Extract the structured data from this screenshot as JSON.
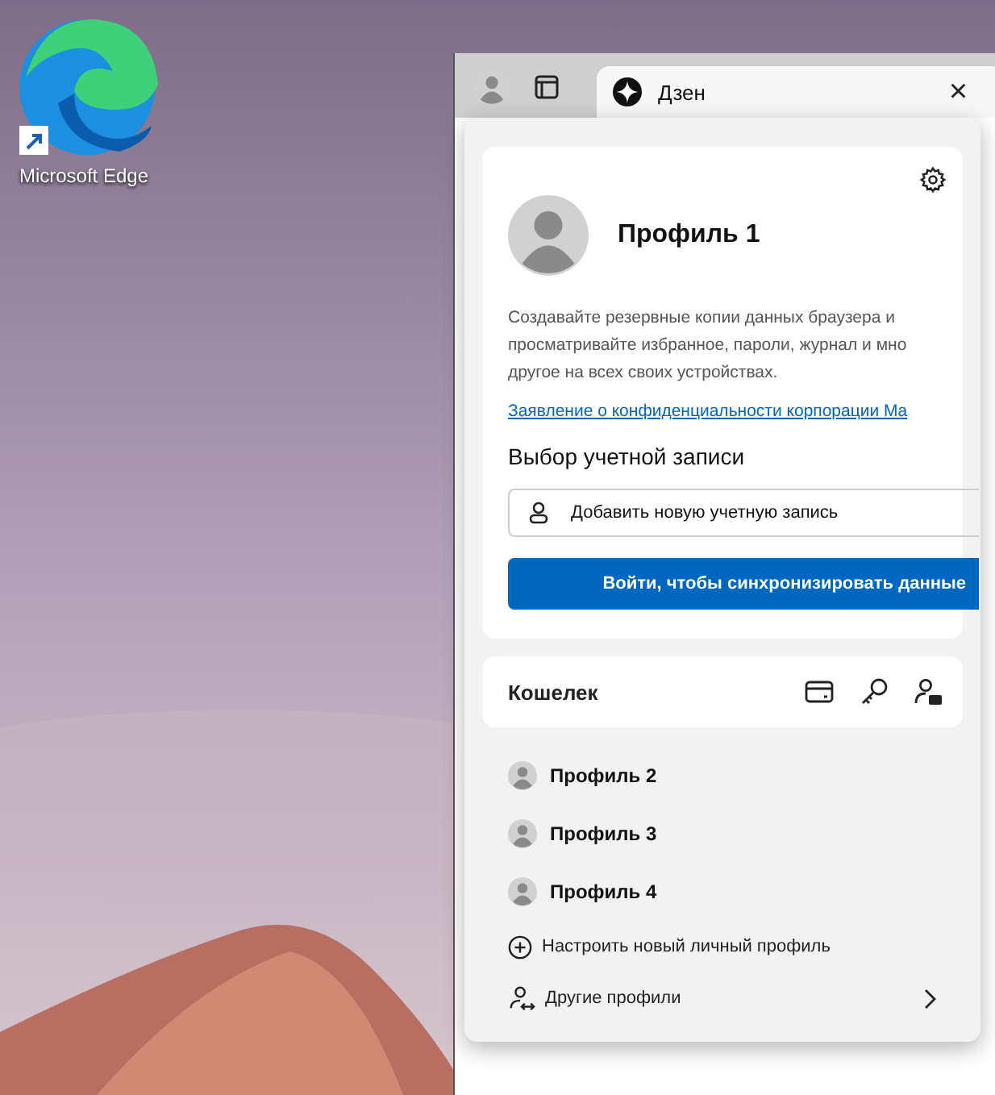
{
  "desktop_icon": {
    "label": "Microsoft Edge"
  },
  "tab": {
    "title": "Дзен",
    "close": "×"
  },
  "profile_card": {
    "name": "Профиль 1",
    "description": [
      "Создавайте резервные копии данных браузера и",
      "просматривайте избранное, пароли, журнал и мно",
      "другое на всех своих устройствах."
    ],
    "privacy_link": "Заявление о конфиденциальности корпорации Ma",
    "account_heading": "Выбор учетной записи",
    "add_account": "Добавить новую учетную запись",
    "sign_in": "Войти, чтобы синхронизировать данные"
  },
  "wallet": {
    "label": "Кошелек"
  },
  "profiles": [
    {
      "name": "Профиль 2"
    },
    {
      "name": "Профиль 3"
    },
    {
      "name": "Профиль 4"
    }
  ],
  "actions": [
    {
      "kind": "add",
      "label": "Настроить новый личный профиль"
    },
    {
      "kind": "other",
      "label": "Другие профили"
    }
  ]
}
